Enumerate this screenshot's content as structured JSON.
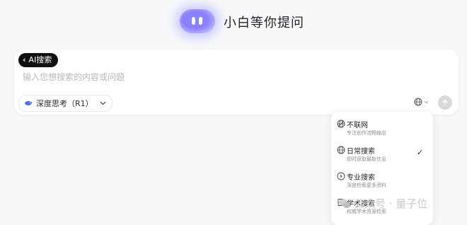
{
  "header": {
    "title": "小白等你提问"
  },
  "input_card": {
    "mode_tag": "AI搜索",
    "placeholder": "输入您想搜索的内容或问题",
    "model_button_label": "深度思考（R1）"
  },
  "search_menu": {
    "items": [
      {
        "label": "不联网",
        "description": "专注创作流畅输出",
        "icon": "no-network-icon",
        "selected": false
      },
      {
        "label": "日常搜索",
        "description": "即时获取最新信息",
        "icon": "globe-icon",
        "selected": true
      },
      {
        "label": "专业搜索",
        "description": "深度检索更多资料",
        "icon": "lightning-icon",
        "selected": false
      },
      {
        "label": "学术搜索",
        "description": "权威学术资源检索",
        "icon": "book-icon",
        "selected": false
      }
    ],
    "check_mark": "✓"
  },
  "watermark": {
    "text": "公众号 · 量子位"
  },
  "colors": {
    "page_background": "#f7f8fa",
    "tag_background": "#111111",
    "mascot_gradient": "#8e7dff"
  }
}
